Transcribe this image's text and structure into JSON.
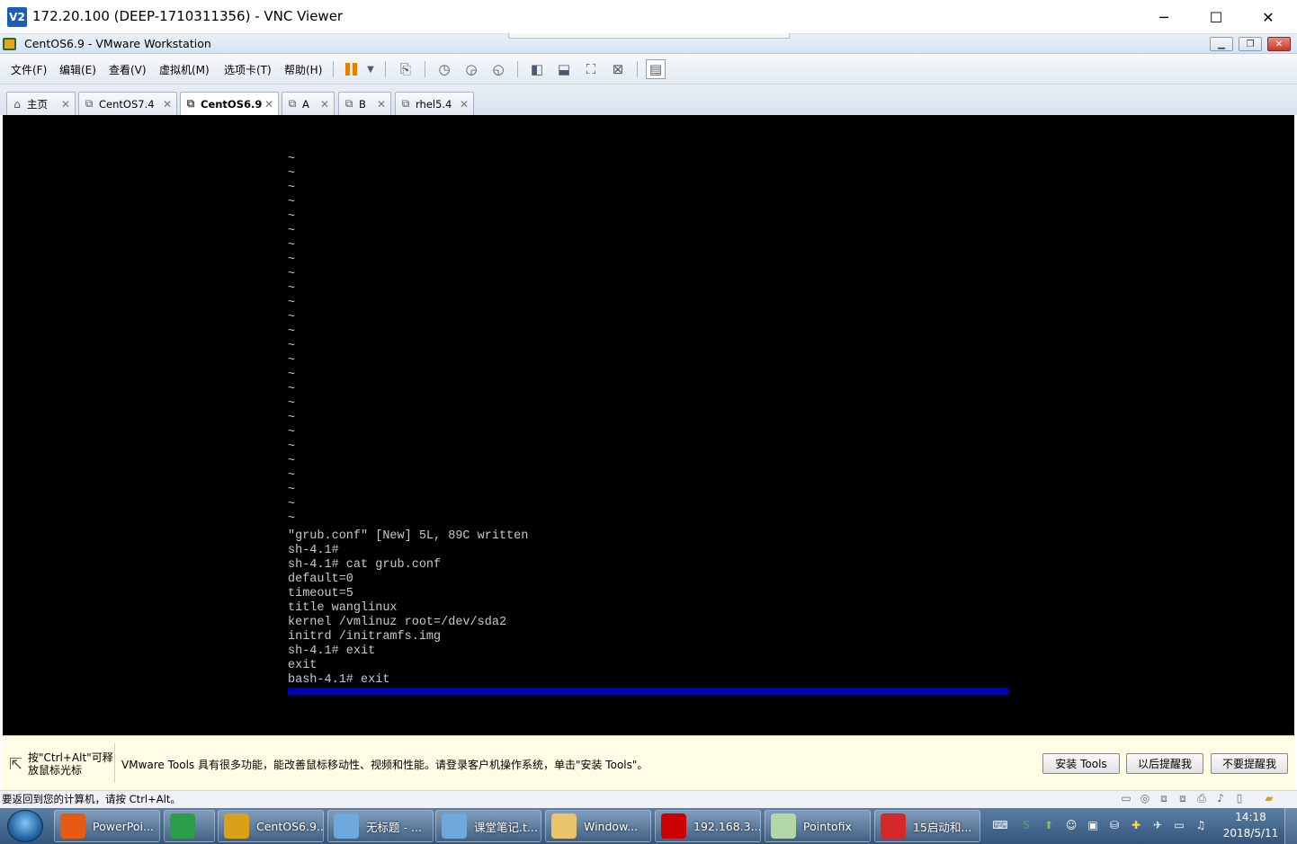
{
  "vnc": {
    "title": "172.20.100 (DEEP-1710311356) - VNC Viewer",
    "logo": "V2",
    "minimize": "─",
    "maximize": "☐",
    "close": "✕"
  },
  "vmware": {
    "title": "CentOS6.9 - VMware Workstation",
    "menu": [
      "文件(F)",
      "编辑(E)",
      "查看(V)",
      "虚拟机(M)",
      "选项卡(T)",
      "帮助(H)"
    ],
    "tabs": [
      {
        "label": "主页",
        "icon": "home-icon"
      },
      {
        "label": "CentOS7.4",
        "icon": "vm-icon"
      },
      {
        "label": "CentOS6.9",
        "icon": "vm-icon",
        "active": true
      },
      {
        "label": "A",
        "icon": "vm-icon"
      },
      {
        "label": "B",
        "icon": "vm-icon"
      },
      {
        "label": "rhel5.4",
        "icon": "vm-icon"
      }
    ]
  },
  "console": {
    "tilde": "~",
    "lines": [
      "\"grub.conf\" [New] 5L, 89C written",
      "sh-4.1#",
      "sh-4.1# cat grub.conf",
      "default=0",
      "timeout=5",
      "title wanglinux",
      "kernel /vmlinuz root=/dev/sda2",
      "initrd /initramfs.img",
      "sh-4.1# exit",
      "exit",
      "bash-4.1# exit"
    ]
  },
  "notification": {
    "hint": "按\"Ctrl+Alt\"可释放鼠标光标",
    "message": "VMware Tools 具有很多功能，能改善鼠标移动性、视频和性能。请登录客户机操作系统，单击\"安装 Tools\"。",
    "install": "安装 Tools",
    "later": "以后提醒我",
    "never": "不要提醒我"
  },
  "status": {
    "text": "要返回到您的计算机，请按 Ctrl+Alt。"
  },
  "taskbar": {
    "items": [
      {
        "label": "PowerPoi...",
        "color": "#e55b13"
      },
      {
        "label": "",
        "color": "#2d9c4a"
      },
      {
        "label": "CentOS6.9...",
        "color": "#d9a019"
      },
      {
        "label": "无标题 - ...",
        "color": "#6fa8dc"
      },
      {
        "label": "课堂笔记.t...",
        "color": "#6fa8dc"
      },
      {
        "label": "Window...",
        "color": "#e9c46a"
      },
      {
        "label": "192.168.3...",
        "color": "#cc0000"
      },
      {
        "label": "Pointofix",
        "color": "#b4d7a8"
      },
      {
        "label": "15启动和...",
        "color": "#d62828"
      }
    ],
    "time": "14:18",
    "date": "2018/5/11"
  }
}
